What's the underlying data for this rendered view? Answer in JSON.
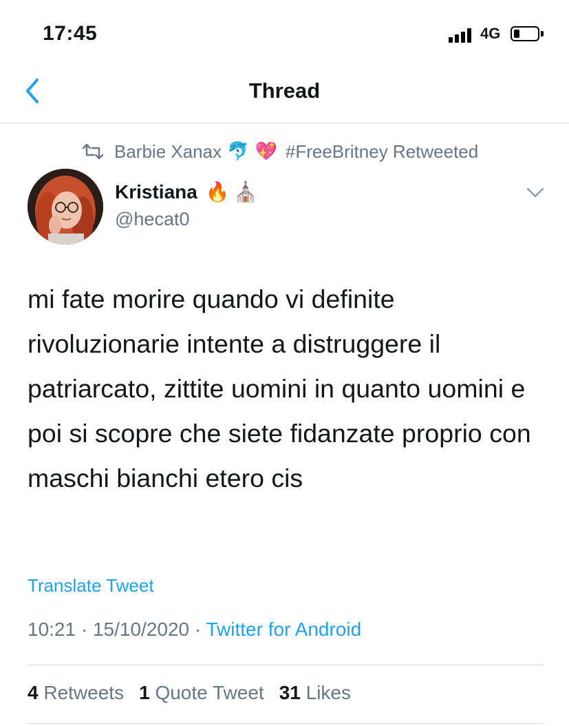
{
  "status_bar": {
    "time": "17:45",
    "network": "4G"
  },
  "nav": {
    "title": "Thread"
  },
  "retweet": {
    "by": "Barbie Xanax",
    "emoji_1": "🐬",
    "emoji_2": "💖",
    "suffix": "#FreeBritney Retweeted"
  },
  "tweet": {
    "display_name": "Kristiana",
    "name_emoji_1": "🔥",
    "name_emoji_2": "⛪",
    "handle": "@hecat0",
    "text": "mi fate morire quando vi definite rivoluzionarie intente a distruggere il patriarcato, zittite uomini in quanto uomini e poi si scopre che siete fidanzate proprio con maschi bianchi etero cis",
    "translate_label": "Translate Tweet",
    "time": "10:21",
    "date": "15/10/2020",
    "source": "Twitter for Android"
  },
  "stats": {
    "retweets_count": "4",
    "retweets_label": "Retweets",
    "quotes_count": "1",
    "quotes_label": "Quote Tweet",
    "likes_count": "31",
    "likes_label": "Likes"
  },
  "colors": {
    "accent": "#1da1f2",
    "muted": "#657786",
    "text": "#14171a"
  }
}
